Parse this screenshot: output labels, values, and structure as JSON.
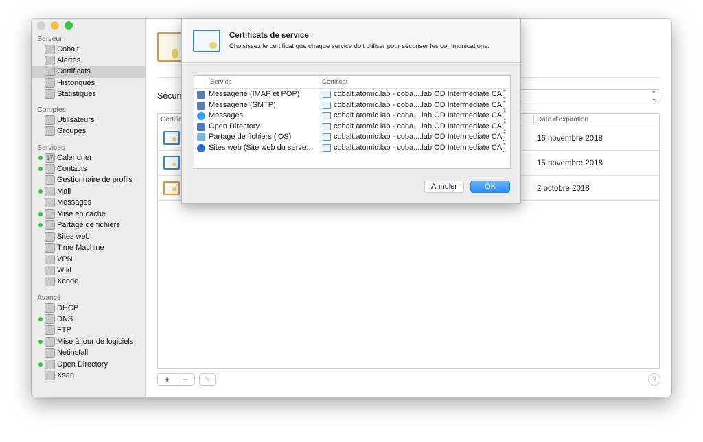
{
  "sidebar": {
    "sections": [
      {
        "title": "Serveur",
        "items": [
          {
            "label": "Cobalt",
            "icon": "server-icon"
          },
          {
            "label": "Alertes",
            "icon": "megaphone-icon"
          },
          {
            "label": "Certificats",
            "icon": "certificate-icon",
            "selected": true
          },
          {
            "label": "Historiques",
            "icon": "log-icon"
          },
          {
            "label": "Statistiques",
            "icon": "stats-icon"
          }
        ]
      },
      {
        "title": "Comptes",
        "items": [
          {
            "label": "Utilisateurs",
            "icon": "user-icon"
          },
          {
            "label": "Groupes",
            "icon": "group-icon"
          }
        ]
      },
      {
        "title": "Services",
        "items": [
          {
            "label": "Calendrier",
            "icon": "calendar-icon",
            "active": true
          },
          {
            "label": "Contacts",
            "icon": "contacts-icon",
            "active": true
          },
          {
            "label": "Gestionnaire de profils",
            "icon": "profile-manager-icon"
          },
          {
            "label": "Mail",
            "icon": "mail-icon",
            "active": true
          },
          {
            "label": "Messages",
            "icon": "messages-icon"
          },
          {
            "label": "Mise en cache",
            "icon": "caching-icon",
            "active": true
          },
          {
            "label": "Partage de fichiers",
            "icon": "file-sharing-icon",
            "active": true
          },
          {
            "label": "Sites web",
            "icon": "globe-icon"
          },
          {
            "label": "Time Machine",
            "icon": "time-machine-icon"
          },
          {
            "label": "VPN",
            "icon": "vpn-lock-icon"
          },
          {
            "label": "Wiki",
            "icon": "wiki-icon"
          },
          {
            "label": "Xcode",
            "icon": "xcode-icon"
          }
        ]
      },
      {
        "title": "Avancé",
        "items": [
          {
            "label": "DHCP",
            "icon": "dhcp-icon"
          },
          {
            "label": "DNS",
            "icon": "dns-icon",
            "active": true
          },
          {
            "label": "FTP",
            "icon": "ftp-icon"
          },
          {
            "label": "Mise à jour de logiciels",
            "icon": "software-update-icon",
            "active": true
          },
          {
            "label": "Netinstall",
            "icon": "netinstall-icon"
          },
          {
            "label": "Open Directory",
            "icon": "open-directory-icon",
            "active": true
          },
          {
            "label": "Xsan",
            "icon": "xsan-icon"
          }
        ]
      }
    ]
  },
  "main": {
    "section_label": "Sécuris",
    "table": {
      "col_cert": "Certific",
      "col_date": "Date d’expiration",
      "rows": [
        {
          "date": "16 novembre 2018",
          "style": "blue"
        },
        {
          "date": "15 novembre 2018",
          "style": "blue"
        },
        {
          "date": "2 octobre 2018",
          "style": "gold"
        }
      ]
    },
    "add": "+",
    "remove": "−",
    "help": "?"
  },
  "dialog": {
    "title": "Certificats de service",
    "subtitle": "Choisissez le certificat que chaque service doit utiliser pour sécuriser les communications.",
    "col_service": "Service",
    "col_cert": "Certificat",
    "rows": [
      {
        "service": "Messagerie (IMAP et POP)",
        "cert": "cobalt.atomic.lab - coba....lab OD Intermediate CA",
        "icon": "mail-icon"
      },
      {
        "service": "Messagerie (SMTP)",
        "cert": "cobalt.atomic.lab - coba....lab OD Intermediate CA",
        "icon": "mail-icon"
      },
      {
        "service": "Messages",
        "cert": "cobalt.atomic.lab - coba....lab OD Intermediate CA",
        "icon": "messages-icon"
      },
      {
        "service": "Open Directory",
        "cert": "cobalt.atomic.lab - coba....lab OD Intermediate CA",
        "icon": "open-directory-icon"
      },
      {
        "service": "Partage de fichiers (iOS)",
        "cert": "cobalt.atomic.lab - coba....lab OD Intermediate CA",
        "icon": "file-sharing-icon"
      },
      {
        "service": "Sites web (Site web du serve…",
        "cert": "cobalt.atomic.lab - coba....lab OD Intermediate CA",
        "icon": "globe-icon"
      }
    ],
    "cancel": "Annuler",
    "ok": "OK"
  },
  "colors": {
    "accent": "#3f9bfb",
    "active_dot": "#34c84a"
  }
}
